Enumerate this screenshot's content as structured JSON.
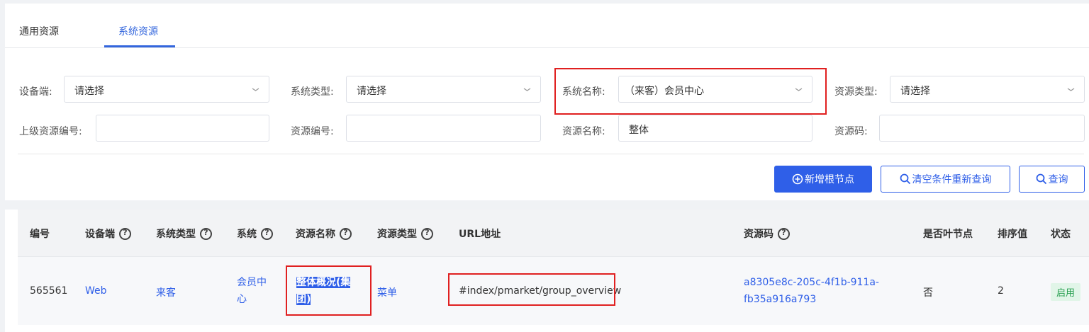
{
  "tabs": {
    "general": "通用资源",
    "system": "系统资源"
  },
  "filters": {
    "device": {
      "label": "设备端:",
      "value": "请选择"
    },
    "system_type": {
      "label": "系统类型:",
      "value": "请选择"
    },
    "system_name": {
      "label": "系统名称:",
      "value": "（来客）会员中心"
    },
    "resource_type": {
      "label": "资源类型:",
      "value": "请选择"
    },
    "parent_code": {
      "label": "上级资源编号:",
      "value": ""
    },
    "resource_code": {
      "label": "资源编号:",
      "value": ""
    },
    "resource_name": {
      "label": "资源名称:",
      "value": "整体"
    },
    "resource_key": {
      "label": "资源码:",
      "value": ""
    }
  },
  "buttons": {
    "add_root": "新增根节点",
    "clear_requery": "清空条件重新查询",
    "query": "查询"
  },
  "table": {
    "headers": {
      "id": "编号",
      "device": "设备端",
      "system_type": "系统类型",
      "system": "系统",
      "resource_name": "资源名称",
      "resource_type": "资源类型",
      "url": "URL地址",
      "resource_code": "资源码",
      "is_leaf": "是否叶节点",
      "sort": "排序值",
      "status": "状态"
    },
    "rows": [
      {
        "id": "565561",
        "device": "Web",
        "system_type": "来客",
        "system_line1": "会员中",
        "system_line2": "心",
        "resource_name_line1": "整体概况(集",
        "resource_name_line2": "团)",
        "resource_type": "菜单",
        "url": "#index/pmarket/group_overview",
        "code_line1": "a8305e8c-205c-4f1b-911a-",
        "code_line2": "fb35a916a793",
        "is_leaf": "否",
        "sort": "2",
        "status": "启用"
      }
    ]
  },
  "colors": {
    "primary": "#2f5fe8",
    "highlight_box": "#e02020",
    "status_green": "#2aa052"
  }
}
